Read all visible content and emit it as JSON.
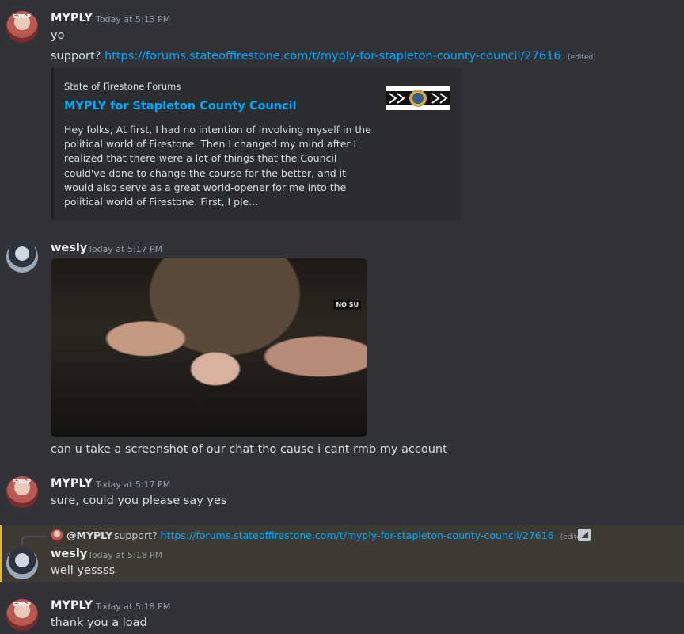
{
  "messages": [
    {
      "user": "MYPLY",
      "time": "Today at 5:13 PM",
      "lines": [
        "yo"
      ],
      "support_prefix": "support?",
      "support_link": "https://forums.stateoffirestone.com/t/myply-for-stapleton-county-council/27616",
      "edited": "(edited)",
      "embed": {
        "provider": "State of Firestone Forums",
        "title": "MYPLY for Stapleton County Council",
        "description": "Hey folks, At first, I had no intention of involving myself in the political world of Firestone. Then I changed my mind after I realized that there were a lot of things that the Council could've done to change the course for the better, and it would also serve as a great world-opener for me into the political world of Firestone. First, I ple..."
      }
    },
    {
      "user": "wesly",
      "time": "Today at 5:17 PM",
      "image_caption": "NO SU",
      "text": "can u take a screenshot of our chat tho cause i cant rmb my account"
    },
    {
      "user": "MYPLY",
      "time": "Today at 5:17 PM",
      "text": "sure, could you please say yes"
    },
    {
      "reply": {
        "mention": "@MYPLY",
        "prefix": "support?",
        "link": "https://forums.stateoffirestone.com/t/myply-for-stapleton-county-council/27616",
        "edited": "(edited)"
      },
      "user": "wesly",
      "time": "Today at 5:18 PM",
      "text": "well yessss"
    },
    {
      "user": "MYPLY",
      "time": "Today at 5:18 PM",
      "text": "thank you a load"
    }
  ]
}
